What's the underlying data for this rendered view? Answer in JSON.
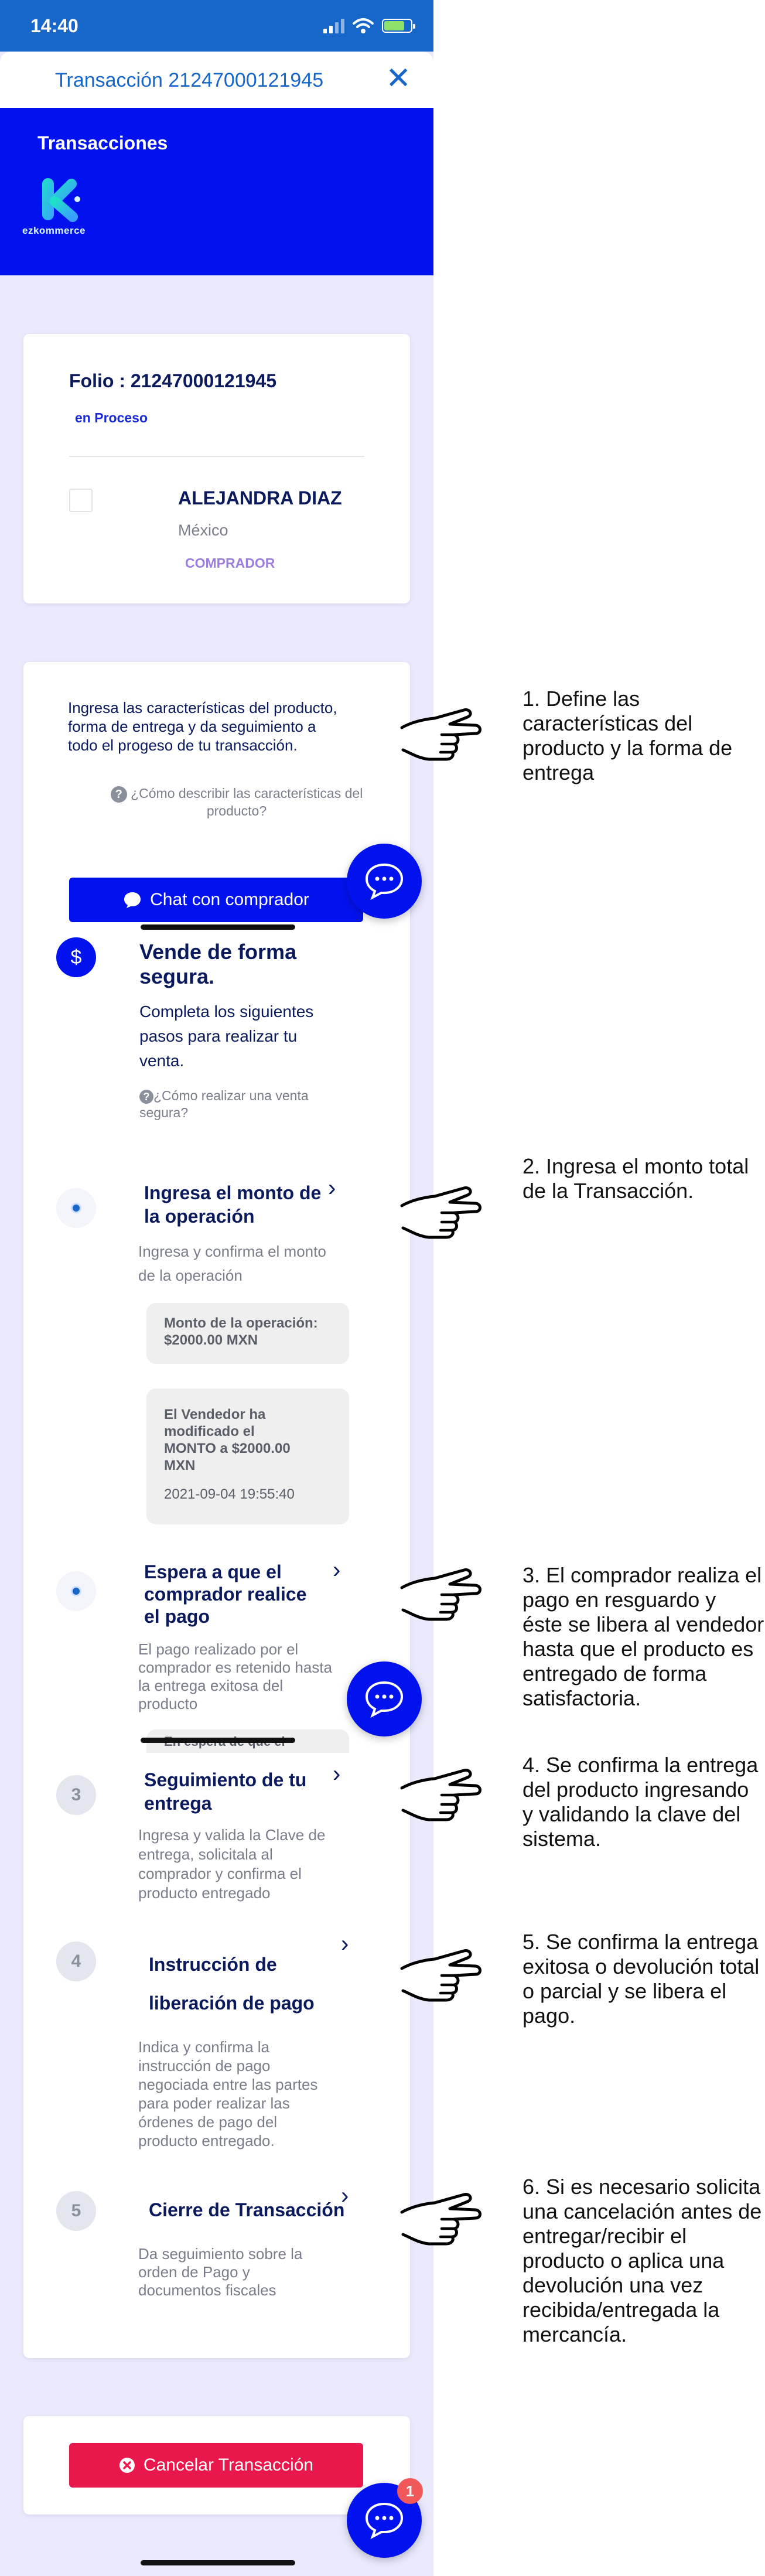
{
  "status_bar": {
    "time": "14:40"
  },
  "header": {
    "title": "Transacción 21247000121945"
  },
  "hero": {
    "title": "Transacciones",
    "brand": "ezkommerce"
  },
  "summary": {
    "folio": "Folio : 21247000121945",
    "status": "en Proceso",
    "buyer_name": "ALEJANDRA DIAZ",
    "buyer_country": "México",
    "buyer_role": "COMPRADOR"
  },
  "intro": {
    "text_lines": [
      "Ingresa las características del producto,",
      "forma de entrega y da seguimiento a",
      "todo el progeso de tu transacción."
    ],
    "help_lines": [
      "¿Cómo describir las características del",
      "producto?"
    ],
    "chat_button": "Chat con comprador"
  },
  "sell_safe": {
    "title_lines": [
      "Vende de forma",
      "segura."
    ],
    "desc_lines": [
      "Completa los siguientes",
      "pasos para realizar tu",
      "venta."
    ],
    "help_lines": [
      "¿Cómo realizar una venta",
      "segura?"
    ]
  },
  "steps": {
    "s1": {
      "title_lines": [
        "Ingresa el monto de",
        "la operación"
      ],
      "desc_lines": [
        "Ingresa y confirma el monto",
        "de la operación"
      ],
      "amount_lines": [
        "Monto de la operación:",
        "$2000.00 MXN"
      ],
      "modified_lines": [
        "El Vendedor ha",
        "modificado el",
        "MONTO a $2000.00",
        "MXN"
      ],
      "modified_date": "2021-09-04 19:55:40"
    },
    "s2": {
      "title_lines": [
        "Espera a que el",
        "comprador realice",
        "el pago"
      ],
      "desc_lines": [
        "El pago realizado por el",
        "comprador es retenido hasta",
        "la entrega exitosa del",
        "producto"
      ],
      "peek": "En espera de que el"
    },
    "s3": {
      "number": "3",
      "title_lines": [
        "Seguimiento de tu",
        "entrega"
      ],
      "desc_lines": [
        "Ingresa y valida la Clave de",
        "entrega, solicitala al",
        "comprador y confirma el",
        "producto entregado"
      ]
    },
    "s4": {
      "number": "4",
      "title_lines": [
        "Instrucción de",
        "liberación de pago"
      ],
      "desc_lines": [
        "Indica y confirma la",
        "instrucción de pago",
        "negociada entre las partes",
        "para poder realizar las",
        "órdenes de pago del",
        "producto entregado."
      ]
    },
    "s5": {
      "number": "5",
      "title": "Cierre de Transacción",
      "desc_lines": [
        "Da seguimiento sobre la",
        "orden de Pago y",
        "documentos fiscales"
      ]
    }
  },
  "cancel_button": "Cancelar Transacción",
  "chat_badge": "1",
  "annotations": {
    "a1": [
      "1. Define las",
      "características del",
      "producto y la forma de",
      "entrega"
    ],
    "a2": [
      "2. Ingresa el monto total",
      "de la Transacción."
    ],
    "a3": [
      "3. El comprador realiza el",
      "pago en resguardo y",
      "éste se libera al vendedor",
      "hasta que el producto es",
      "entregado de forma",
      "satisfactoria."
    ],
    "a4": [
      "4. Se confirma la entrega",
      "del producto ingresando",
      "y validando la clave del",
      "sistema."
    ],
    "a5": [
      "5. Se confirma la entrega",
      "exitosa o devolución total",
      "o parcial y se libera el",
      "pago."
    ],
    "a6": [
      "6. Si es necesario solicita",
      "una cancelación antes de",
      "entregar/recibir el",
      "producto o aplica una",
      "devolución una vez",
      "recibida/entregada la",
      "mercancía."
    ]
  },
  "colors": {
    "status_bar": "#1766c9",
    "hero": "#0212ee",
    "primary_button": "#0212ee",
    "cancel_button": "#e8184c",
    "badge": "#f0585a",
    "page_bg": "#ebeafd"
  },
  "icons": [
    "signal-icon",
    "wifi-icon",
    "battery-icon",
    "close-icon",
    "chat-bubble-icon",
    "dollar-icon",
    "help-icon",
    "chevron-right-icon",
    "cancel-circle-icon",
    "pointing-hand-icon"
  ]
}
